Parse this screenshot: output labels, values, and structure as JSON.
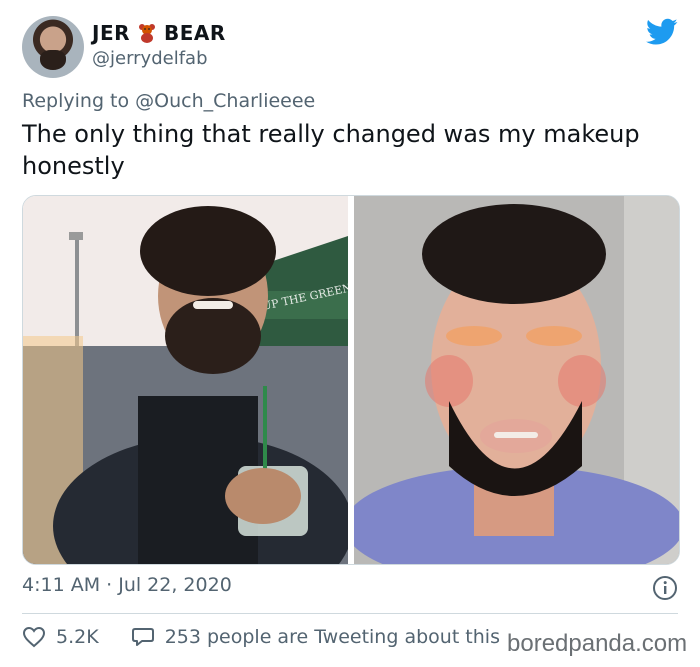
{
  "tweet": {
    "display_name_part1": "JER",
    "display_name_emoji": "teddy-bear-emoji",
    "display_name_part2": "BEAR",
    "handle": "@jerrydelfab",
    "replying_prefix": "Replying to",
    "replying_to": "@Ouch_Charlieeee",
    "text": "The only thing that really changed was my makeup honestly",
    "timestamp": "4:11 AM · Jul 22, 2020",
    "likes": "5.2K",
    "retweet_text": "253 people are Tweeting about this"
  },
  "media": {
    "left_photo_sign": "UP THE GREEN"
  },
  "watermark": "boredpanda.com",
  "colors": {
    "twitter_blue": "#1d9bf0",
    "secondary_text": "#536471",
    "primary_text": "#0f1419",
    "divider": "#cfd9de"
  },
  "icons": [
    "twitter-bird-icon",
    "info-icon",
    "heart-icon",
    "comment-bubble-icon"
  ]
}
